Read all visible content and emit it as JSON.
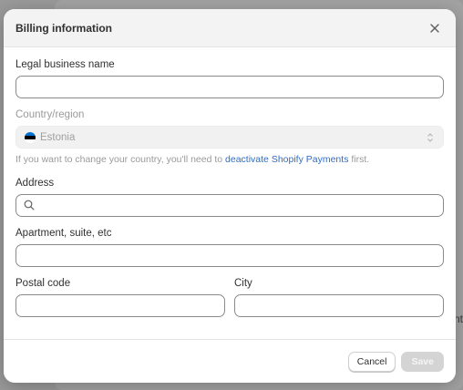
{
  "modal": {
    "title": "Billing information",
    "close_icon": "close-icon"
  },
  "form": {
    "legal_name": {
      "label": "Legal business name",
      "value": "",
      "placeholder": ""
    },
    "country": {
      "label": "Country/region",
      "value": "Estonia",
      "flag_colors": [
        "#0072ce",
        "#000000",
        "#ffffff"
      ],
      "help_prefix": "If you want to change your country, you'll need to ",
      "help_link": "deactivate Shopify Payments",
      "help_suffix": " first."
    },
    "address": {
      "label": "Address",
      "value": "",
      "placeholder": ""
    },
    "apartment": {
      "label": "Apartment, suite, etc",
      "value": "",
      "placeholder": ""
    },
    "postal_code": {
      "label": "Postal code",
      "value": "",
      "placeholder": ""
    },
    "city": {
      "label": "City",
      "value": "",
      "placeholder": ""
    }
  },
  "footer": {
    "cancel_label": "Cancel",
    "save_label": "Save"
  },
  "background": {
    "partial_text": "nt"
  }
}
